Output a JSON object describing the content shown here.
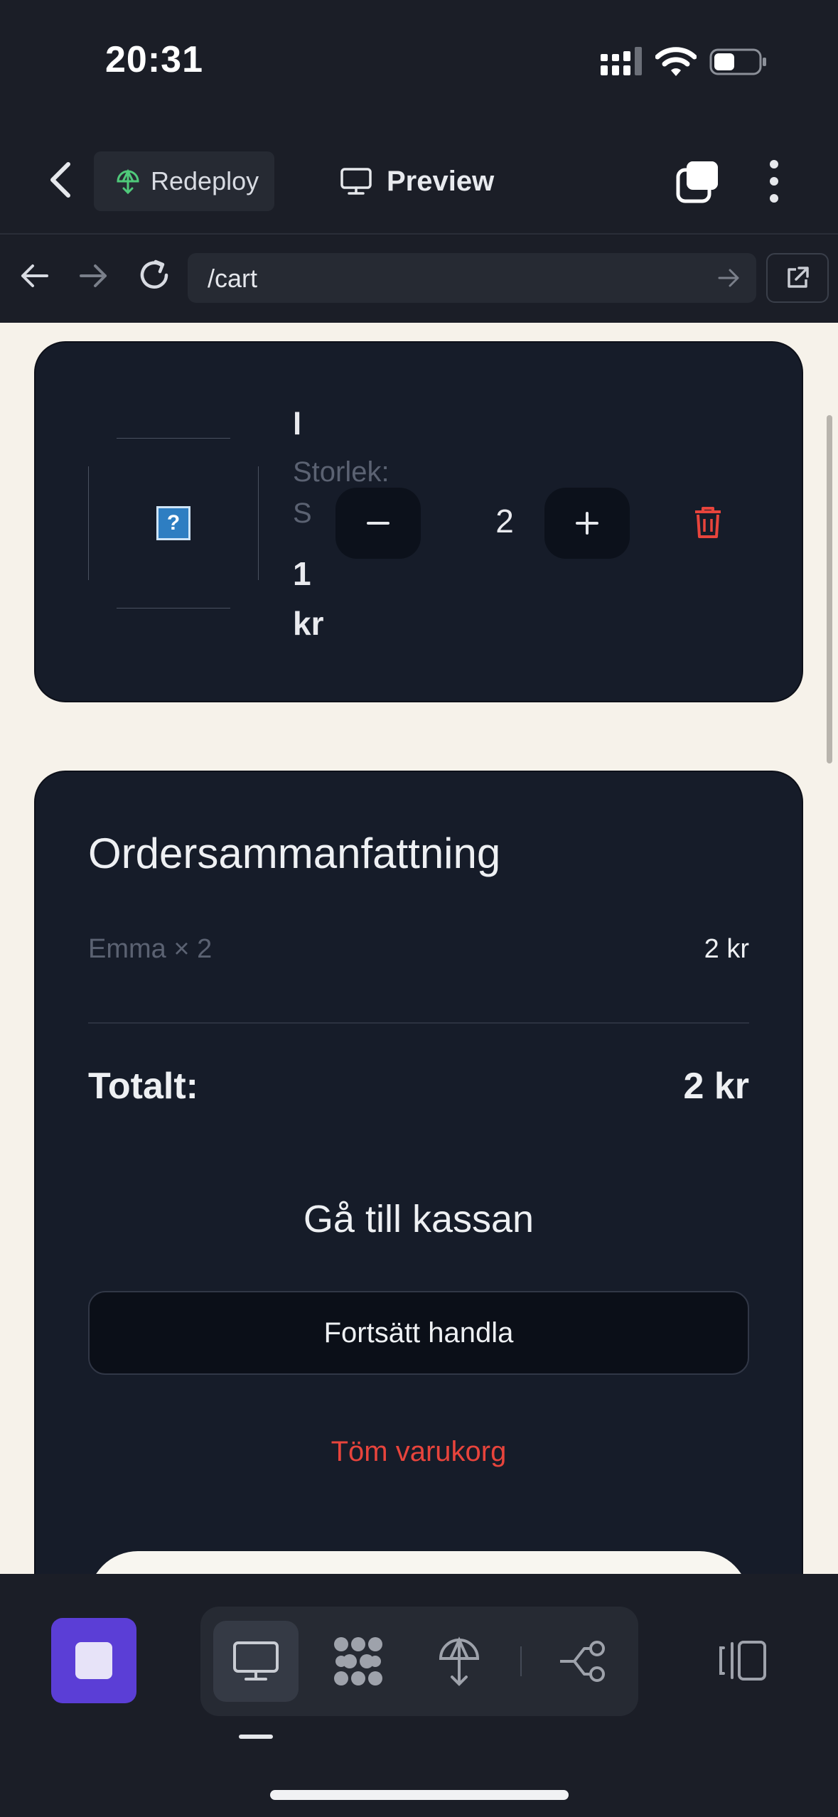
{
  "status_bar": {
    "time": "20:31"
  },
  "toolbar": {
    "redeploy_label": "Redeploy",
    "preview_label": "Preview"
  },
  "browser": {
    "url": "/cart"
  },
  "cart": {
    "item": {
      "name": "l",
      "size_label": "Storlek:",
      "size_value": "S",
      "price": "1 kr",
      "quantity": "2",
      "minus_symbol": "−",
      "plus_symbol": "+",
      "image_placeholder": "?"
    }
  },
  "summary": {
    "title": "Ordersammanfattning",
    "line_item": "Emma × 2",
    "line_price": "2 kr",
    "total_label": "Totalt:",
    "total_value": "2 kr",
    "checkout_label": "Gå till kassan",
    "continue_label": "Fortsätt handla",
    "empty_label": "Töm varukorg"
  },
  "colors": {
    "accent_purple": "#5b3ed6",
    "danger_red": "#e8443c",
    "card_bg": "#161c29",
    "page_bg": "#f6f2ea"
  },
  "icons": {
    "toolbar": [
      "chevron-left-icon",
      "redeploy-icon",
      "monitor-icon",
      "tabs-icon",
      "more-vertical-icon"
    ],
    "urlbar": [
      "arrow-left-icon",
      "arrow-right-icon",
      "reload-icon",
      "go-arrow-icon",
      "external-link-icon"
    ],
    "dock": [
      "stop-icon",
      "monitor-icon",
      "apps-grid-icon",
      "deploy-icon",
      "workflow-icon",
      "side-panel-icon"
    ]
  }
}
